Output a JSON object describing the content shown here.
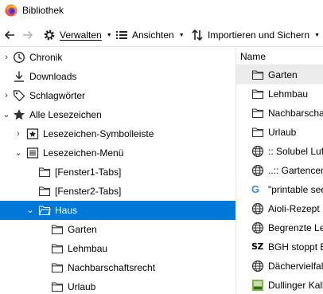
{
  "window": {
    "title": "Bibliothek"
  },
  "toolbar": {
    "manage_label": "Verwalten",
    "views_label": "Ansichten",
    "import_label": "Importieren und Sichern"
  },
  "tree": {
    "history": "Chronik",
    "downloads": "Downloads",
    "tags": "Schlagwörter",
    "all_bookmarks": "Alle Lesezeichen",
    "bookmarks_toolbar": "Lesezeichen-Symbolleiste",
    "bookmarks_menu": "Lesezeichen-Menü",
    "window1_tabs": "[Fenster1-Tabs]",
    "window2_tabs": "[Fenster2-Tabs]",
    "haus": "Haus",
    "garten": "Garten",
    "lehmbau": "Lehmbau",
    "nachbarschaftsrecht": "Nachbarschaftsrecht",
    "urlaub": "Urlaub"
  },
  "list": {
    "column_name": "Name",
    "items": [
      "Garten",
      "Lehmbau",
      "Nachbarscha",
      "Urlaub",
      ":: Solubel Luf",
      "..:: Gartencen",
      "\"printable see",
      "Aioli-Rezept",
      "Begrenzte Lel",
      "BGH stoppt B",
      "Dächervielfal",
      "Dullinger Kall"
    ]
  },
  "colors": {
    "selection": "#0078d7",
    "highlight": "#ececec"
  }
}
